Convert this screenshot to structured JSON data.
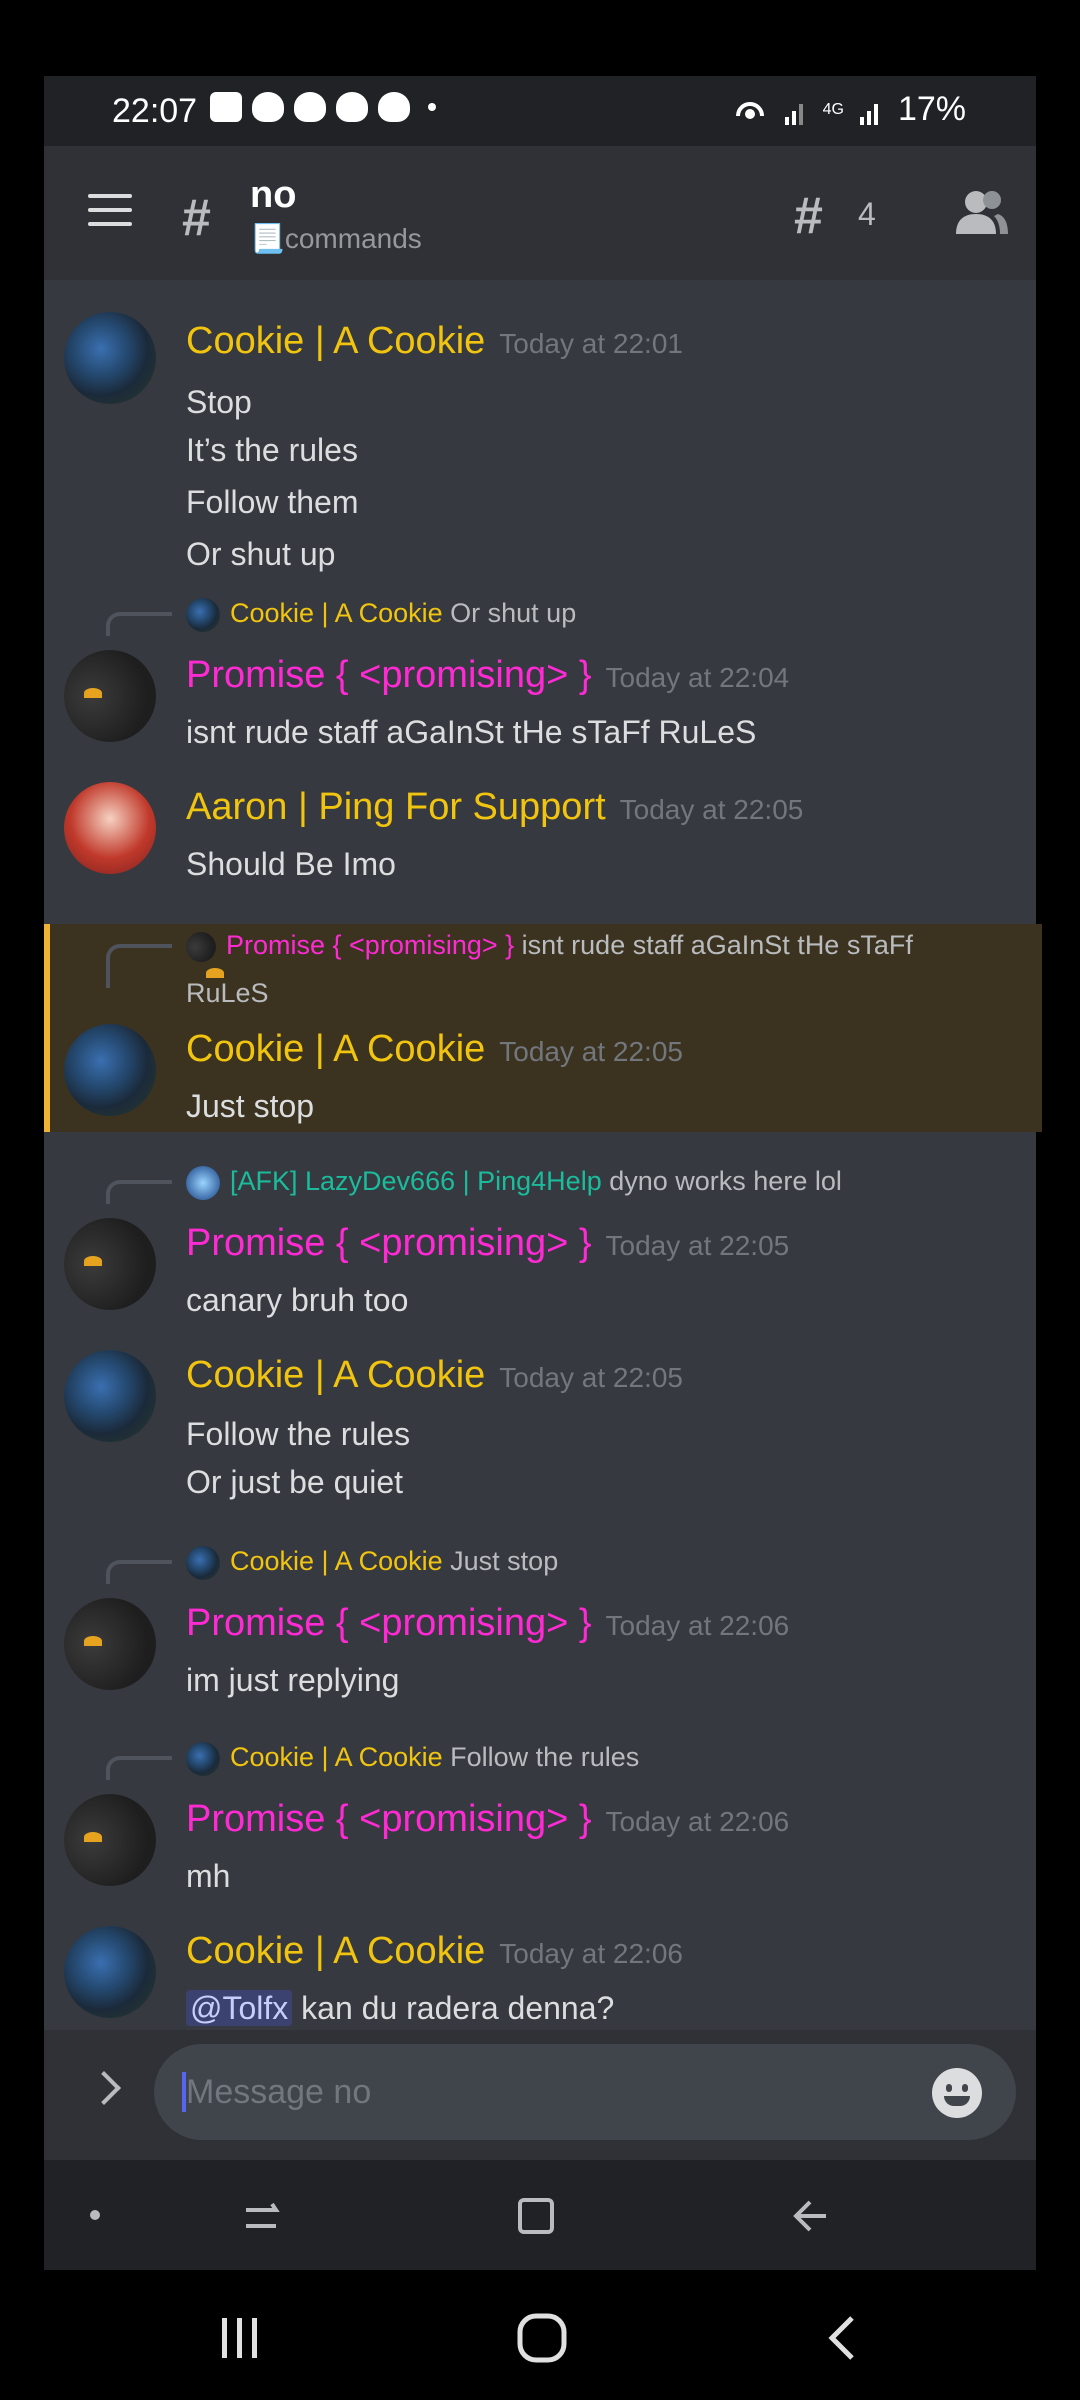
{
  "status_bar": {
    "time": "22:07",
    "network": "4G",
    "battery": "17%"
  },
  "channel": {
    "name": "no",
    "subtitle": "📃commands",
    "threads_count": "4"
  },
  "messages": [
    {
      "author": "Cookie | A Cookie",
      "time": "Today at 22:01",
      "lines": [
        "Stop",
        "It’s the rules",
        "Follow them",
        "Or shut up"
      ]
    },
    {
      "reply_to_author": "Cookie | A Cookie",
      "reply_to_text": "Or shut up",
      "author": "Promise { <promising> }",
      "time": "Today at 22:04",
      "lines": [
        "isnt rude staff aGaInSt tHe sTaFf RuLeS"
      ]
    },
    {
      "author": "Aaron | Ping For Support",
      "time": "Today at 22:05",
      "lines": [
        "Should Be Imo"
      ]
    },
    {
      "reply_to_author": "Promise { <promising> }",
      "reply_to_text": "isnt rude staff aGaInSt tHe sTaFf",
      "reply_to_text_cont": "RuLeS",
      "author": "Cookie | A Cookie",
      "time": "Today at 22:05",
      "lines": [
        "Just stop"
      ]
    },
    {
      "reply_to_author": "[AFK] LazyDev666 | Ping4Help",
      "reply_to_text": "dyno works here lol",
      "author": "Promise { <promising> }",
      "time": "Today at 22:05",
      "lines": [
        "canary bruh too"
      ]
    },
    {
      "author": "Cookie | A Cookie",
      "time": "Today at 22:05",
      "lines": [
        "Follow the rules",
        "Or just be quiet"
      ]
    },
    {
      "reply_to_author": "Cookie | A Cookie",
      "reply_to_text": "Just stop",
      "author": "Promise { <promising> }",
      "time": "Today at 22:06",
      "lines": [
        "im just replying"
      ]
    },
    {
      "reply_to_author": "Cookie | A Cookie",
      "reply_to_text": "Follow the rules",
      "author": "Promise { <promising> }",
      "time": "Today at 22:06",
      "lines": [
        "mh"
      ]
    },
    {
      "author": "Cookie | A Cookie",
      "time": "Today at 22:06",
      "mention": "@Tolfx",
      "lines": [
        " kan du radera denna?"
      ]
    }
  ],
  "composer": {
    "placeholder": "Message no"
  },
  "colors": {
    "cookie_role": "#f1c40f",
    "promise_role": "#ff2ad4",
    "lazydev_role": "#1abc9c",
    "highlight": "#f0b232"
  },
  "icons": [
    "hamburger-menu-icon",
    "thread-hash-icon",
    "threads-icon",
    "members-icon",
    "chevron-right-icon",
    "emoji-icon"
  ]
}
